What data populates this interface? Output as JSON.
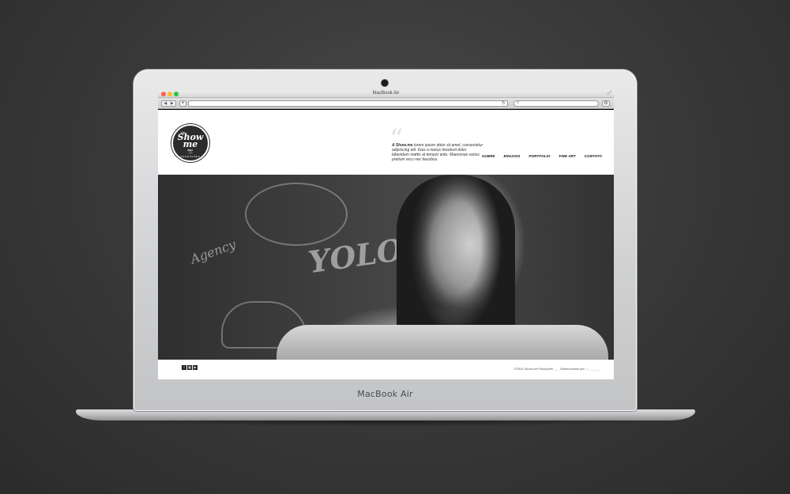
{
  "device": {
    "label": "MacBook Air"
  },
  "browser": {
    "window_title": "MacBook Air",
    "url": "",
    "search_placeholder": "",
    "icons": [
      "back-arrow-icon",
      "forward-arrow-icon",
      "plus-icon",
      "reload-icon",
      "search-icon",
      "gear-icon",
      "resize-icon"
    ],
    "traffic_lights": [
      "#ff5f57",
      "#febc2e",
      "#28c840"
    ]
  },
  "site": {
    "logo": {
      "tm": "tm",
      "word": "Show me",
      "camera": "📷",
      "subtitle": "PRODUÇÕES"
    },
    "quote": {
      "brand": "A Show.me",
      "text": " lorem ipsum dolor sit amet, consectetur adipiscing elit. Duis a metus tincidunt dolor bibendum mattis at tempor ante. Maecenas varius pretium arcu nec faucibus."
    },
    "nav": [
      {
        "label": "SOBRE"
      },
      {
        "label": "ENSAIOS"
      },
      {
        "label": "PORTFOLIO"
      },
      {
        "label": "FINE ART"
      },
      {
        "label": "CONTATO"
      }
    ],
    "hero": {
      "chalk_words": [
        "YOLO",
        "Agency"
      ]
    },
    "footer": {
      "social": [
        "f",
        "▦",
        "▶"
      ],
      "copyright": "©2014 Show.me Produções ___ Desenvolvido por ..:: ______"
    }
  }
}
